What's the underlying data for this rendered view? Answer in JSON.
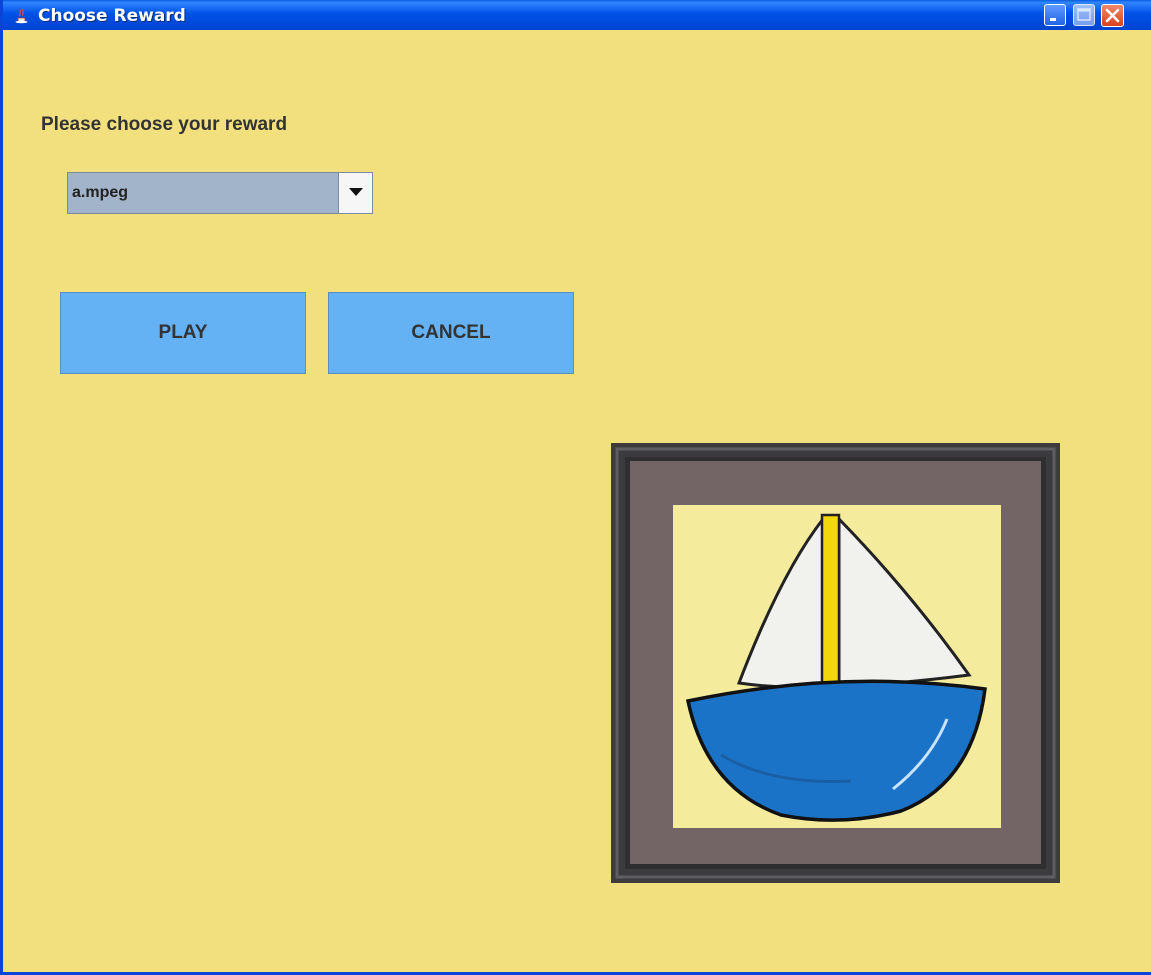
{
  "window": {
    "title": "Choose Reward",
    "icon": "java-cup-icon",
    "controls": [
      "minimize-icon",
      "maximize-icon",
      "close-icon"
    ]
  },
  "form": {
    "prompt": "Please choose your reward",
    "reward_select": {
      "selected": "a.mpeg",
      "icon": "chevron-down-icon"
    },
    "play_label": "PLAY",
    "cancel_label": "CANCEL"
  },
  "preview": {
    "subject": "framed-sailboat-painting"
  },
  "colors": {
    "background": "#f2e07f",
    "button": "#64b1f3",
    "combo": "#a2b4c9",
    "titlebar": "#0052e6"
  }
}
